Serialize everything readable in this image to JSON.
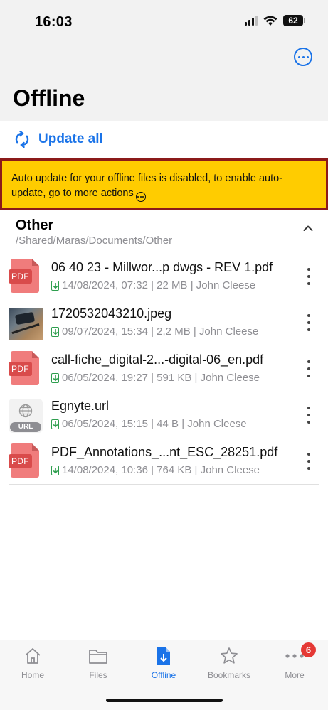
{
  "status_bar": {
    "time": "16:03",
    "battery": "62"
  },
  "header": {
    "title": "Offline",
    "more_icon": "more-circle-icon"
  },
  "update": {
    "label": "Update all",
    "icon": "refresh-icon"
  },
  "banner": {
    "text": "Auto update for your offline files is disabled, to enable auto-update, go to more actions"
  },
  "section": {
    "title": "Other",
    "path": "/Shared/Maras/Documents/Other"
  },
  "files": [
    {
      "name": "06 40 23 - Millwor...p dwgs - REV 1.pdf",
      "meta": "14/08/2024, 07:32 | 22 MB | John Cleese",
      "thumb": "pdf",
      "thumb_label": "PDF"
    },
    {
      "name": "1720532043210.jpeg",
      "meta": "09/07/2024, 15:34 | 2,2 MB | John Cleese",
      "thumb": "photo",
      "thumb_label": ""
    },
    {
      "name": "call-fiche_digital-2...-digital-06_en.pdf",
      "meta": "06/05/2024, 19:27 | 591 KB | John Cleese",
      "thumb": "pdf",
      "thumb_label": "PDF"
    },
    {
      "name": "Egnyte.url",
      "meta": "06/05/2024, 15:15 | 44 B | John Cleese",
      "thumb": "url",
      "thumb_label": "URL"
    },
    {
      "name": "PDF_Annotations_...nt_ESC_28251.pdf",
      "meta": "14/08/2024, 10:36 | 764 KB | John Cleese",
      "thumb": "pdf",
      "thumb_label": "PDF"
    }
  ],
  "tabs": [
    {
      "label": "Home",
      "icon": "home-icon"
    },
    {
      "label": "Files",
      "icon": "folder-icon"
    },
    {
      "label": "Offline",
      "icon": "offline-file-icon",
      "active": true
    },
    {
      "label": "Bookmarks",
      "icon": "star-icon"
    },
    {
      "label": "More",
      "icon": "more-dots-icon",
      "badge": "6"
    }
  ],
  "colors": {
    "accent": "#1a73e8",
    "banner": "#ffcc00",
    "banner_border": "#8b1a1a",
    "badge": "#e53935",
    "pdf": "#f07c7c",
    "download": "#2e9e4e"
  }
}
